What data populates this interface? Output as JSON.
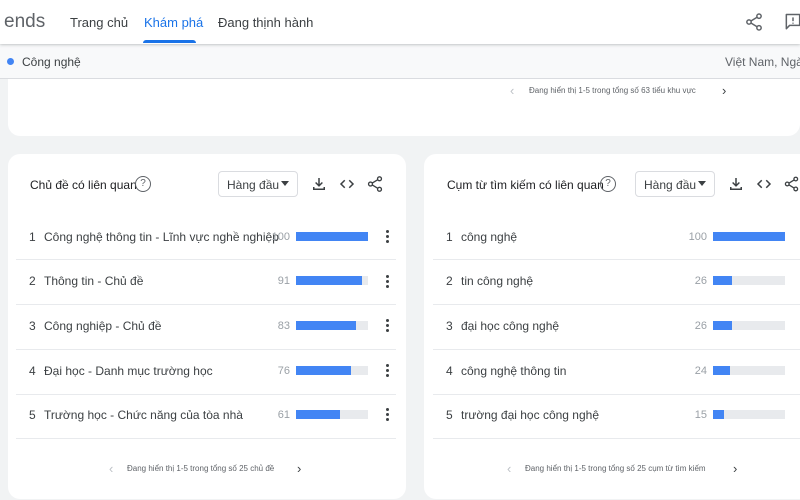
{
  "header": {
    "brand_fragment": "ends",
    "tabs": [
      {
        "label": "Trang chủ",
        "active": false
      },
      {
        "label": "Khám phá",
        "active": true
      },
      {
        "label": "Đang thịnh hành",
        "active": false
      }
    ],
    "icons": [
      "share-icon",
      "feedback-icon"
    ]
  },
  "filter": {
    "topic": "Công nghệ",
    "location_fragment": "Việt Nam, Ngày"
  },
  "subregion_card": {
    "pager_text": "Đang hiển thị 1-5 trong tổng số 63 tiểu khu vực"
  },
  "related_topics": {
    "title": "Chủ đề có liên quan",
    "dropdown": "Hàng đầu",
    "rows": [
      {
        "rank": "1",
        "label": "Công nghệ thông tin - Lĩnh vực nghề nghiệp",
        "value": 100
      },
      {
        "rank": "2",
        "label": "Thông tin - Chủ đề",
        "value": 91
      },
      {
        "rank": "3",
        "label": "Công nghiệp - Chủ đề",
        "value": 83
      },
      {
        "rank": "4",
        "label": "Đại học - Danh mục trường học",
        "value": 76
      },
      {
        "rank": "5",
        "label": "Trường học - Chức năng của tòa nhà",
        "value": 61
      }
    ],
    "pager_text": "Đang hiển thị 1-5 trong tổng số 25 chủ đề"
  },
  "related_queries": {
    "title": "Cụm từ tìm kiếm có liên quan",
    "dropdown": "Hàng đầu",
    "rows": [
      {
        "rank": "1",
        "label": "công nghệ",
        "value": 100
      },
      {
        "rank": "2",
        "label": "tin công nghệ",
        "value": 26
      },
      {
        "rank": "3",
        "label": "đại học công nghệ",
        "value": 26
      },
      {
        "rank": "4",
        "label": "công nghệ thông tin",
        "value": 24
      },
      {
        "rank": "5",
        "label": "trường đại học công nghệ",
        "value": 15
      }
    ],
    "pager_text": "Đang hiển thị 1-5 trong tổng số 25 cụm từ tìm kiếm"
  },
  "colors": {
    "accent": "#1a73e8",
    "bar": "#4285f4",
    "bar_track": "#e8eaed",
    "background": "#f1f3f4"
  }
}
